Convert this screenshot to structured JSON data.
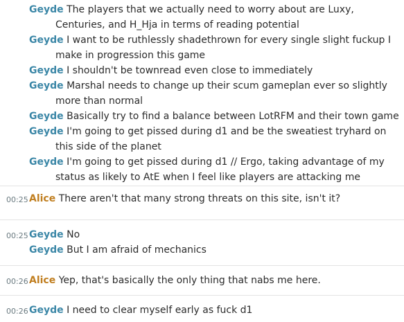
{
  "colors": {
    "geyde": "#3a86a6",
    "alice": "#c07e1f"
  },
  "groups": [
    {
      "time": "",
      "messages": [
        {
          "user": "Geyde",
          "text": "The players that we actually need to worry about are Luxy, Centuries, and H_Hja in terms of reading potential"
        },
        {
          "user": "Geyde",
          "text": "I want to be ruthlessly shadethrown for every single slight fuckup I make in progression this game"
        },
        {
          "user": "Geyde",
          "text": "I shouldn't be townread even close to immediately"
        },
        {
          "user": "Geyde",
          "text": "Marshal needs to change up their scum gameplan ever so slightly more than normal"
        },
        {
          "user": "Geyde",
          "text": "Basically try to find a balance between LotRFM and their town game"
        },
        {
          "user": "Geyde",
          "text": "I'm going to get pissed during d1 and be the sweatiest tryhard on this side of the planet"
        },
        {
          "user": "Geyde",
          "text": "I'm going to get pissed during d1  // Ergo, taking advantage of my status as likely to AtE when I feel like players are attacking me"
        }
      ]
    },
    {
      "time": "00:25",
      "messages": [
        {
          "user": "Alice",
          "text": "There aren't that many strong threats on this site, isn't it?"
        }
      ]
    },
    {
      "time": "00:25",
      "messages": [
        {
          "user": "Geyde",
          "text": "No"
        },
        {
          "user": "Geyde",
          "text": "But I am afraid of mechanics"
        }
      ]
    },
    {
      "time": "00:26",
      "messages": [
        {
          "user": "Alice",
          "text": "Yep, that's basically the only thing that nabs me here."
        }
      ]
    },
    {
      "time": "00:26",
      "messages": [
        {
          "user": "Geyde",
          "text": "I need to clear myself early as fuck d1"
        }
      ]
    }
  ]
}
